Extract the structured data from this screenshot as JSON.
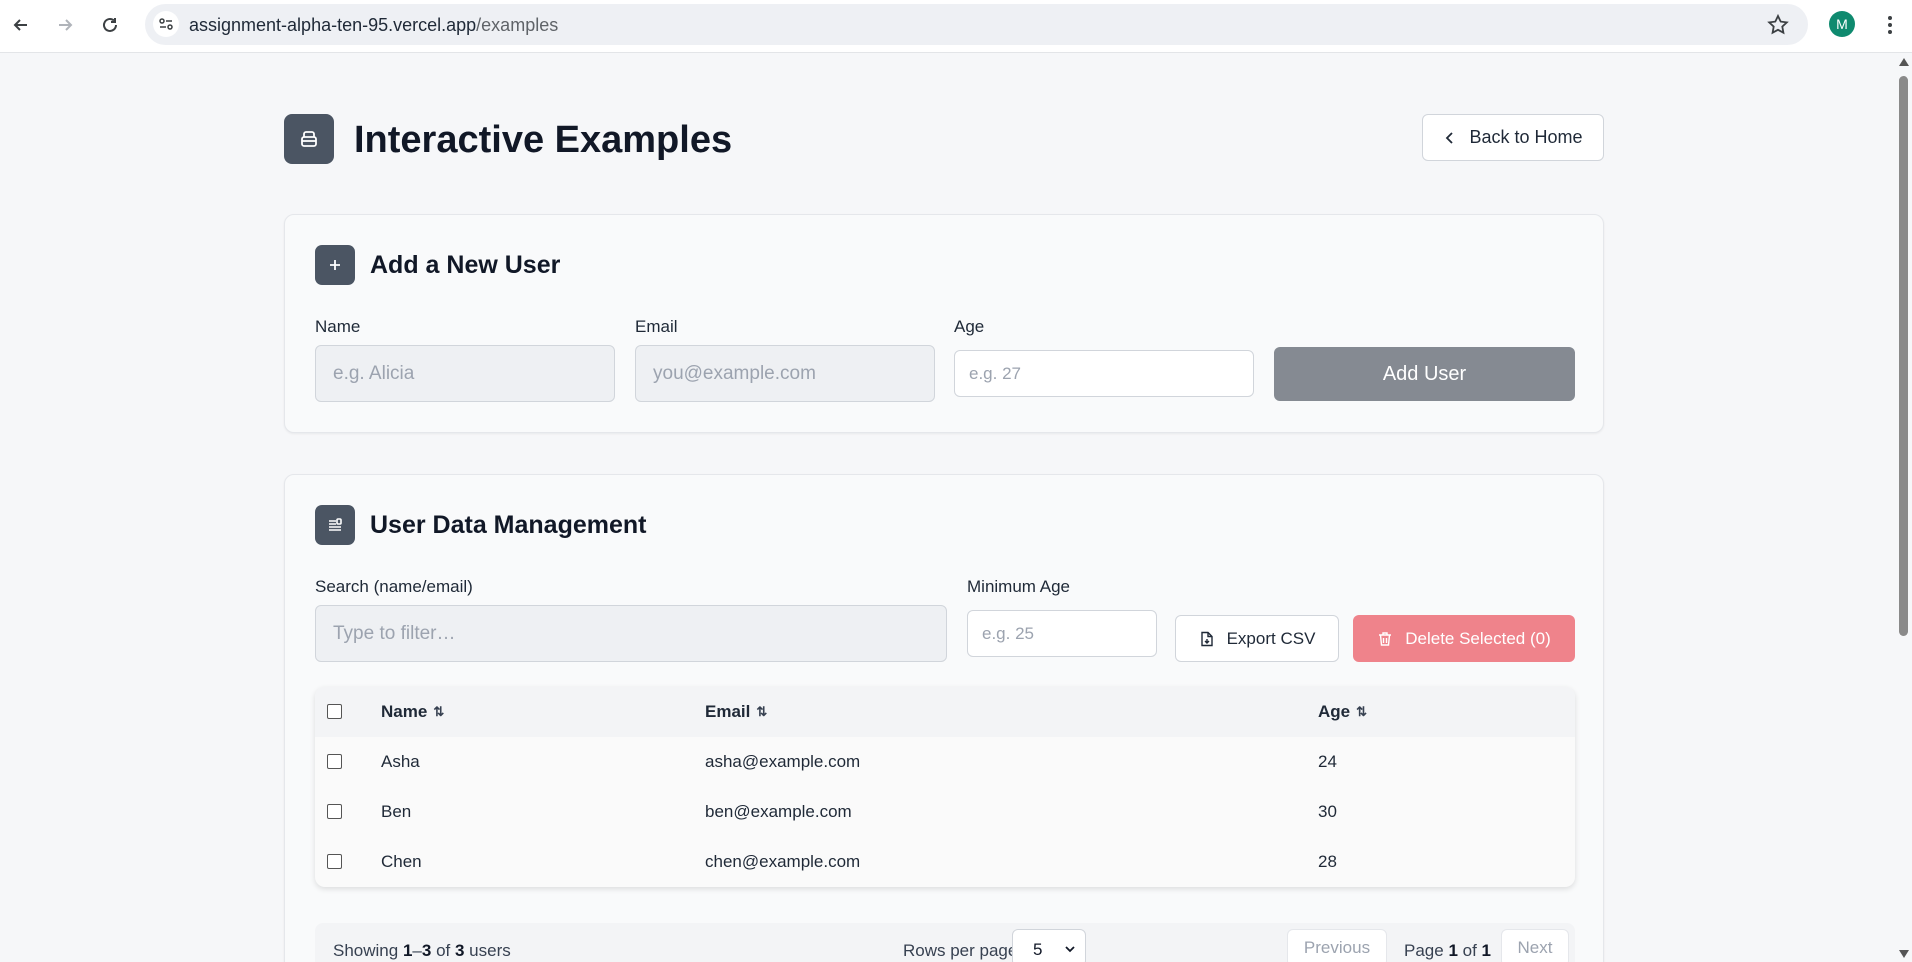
{
  "browser": {
    "url_host": "assignment-alpha-ten-95.vercel.app",
    "url_path": "/examples",
    "profile_initial": "M"
  },
  "header": {
    "title": "Interactive Examples",
    "back_label": "Back to Home"
  },
  "add_user": {
    "title": "Add a New User",
    "name_label": "Name",
    "name_placeholder": "e.g. Alicia",
    "email_label": "Email",
    "email_placeholder": "you@example.com",
    "age_label": "Age",
    "age_placeholder": "e.g. 27",
    "submit_label": "Add User"
  },
  "data_mgmt": {
    "title": "User Data Management",
    "search_label": "Search (name/email)",
    "search_placeholder": "Type to filter…",
    "min_age_label": "Minimum Age",
    "min_age_placeholder": "e.g. 25",
    "export_label": "Export CSV",
    "delete_label": "Delete Selected (0)",
    "columns": {
      "name": "Name",
      "email": "Email",
      "age": "Age",
      "sort_glyph": "⇅"
    },
    "rows": [
      {
        "name": "Asha",
        "email": "asha@example.com",
        "age": "24"
      },
      {
        "name": "Ben",
        "email": "ben@example.com",
        "age": "30"
      },
      {
        "name": "Chen",
        "email": "chen@example.com",
        "age": "28"
      }
    ]
  },
  "pagination": {
    "showing_prefix": "Showing ",
    "range_start": "1",
    "range_sep": "–",
    "range_end": "3",
    "of_text": " of ",
    "total": "3",
    "suffix": " users",
    "rows_per_page_label": "Rows per page",
    "rows_per_page_value": "5",
    "previous_label": "Previous",
    "page_prefix": "Page ",
    "page_current": "1",
    "page_of": " of ",
    "page_total": "1",
    "next_label": "Next"
  },
  "colors": {
    "accent_dark": "#4b5563",
    "add_button": "#858a92",
    "delete_button": "#ef838b",
    "profile": "#0f8a6f"
  }
}
